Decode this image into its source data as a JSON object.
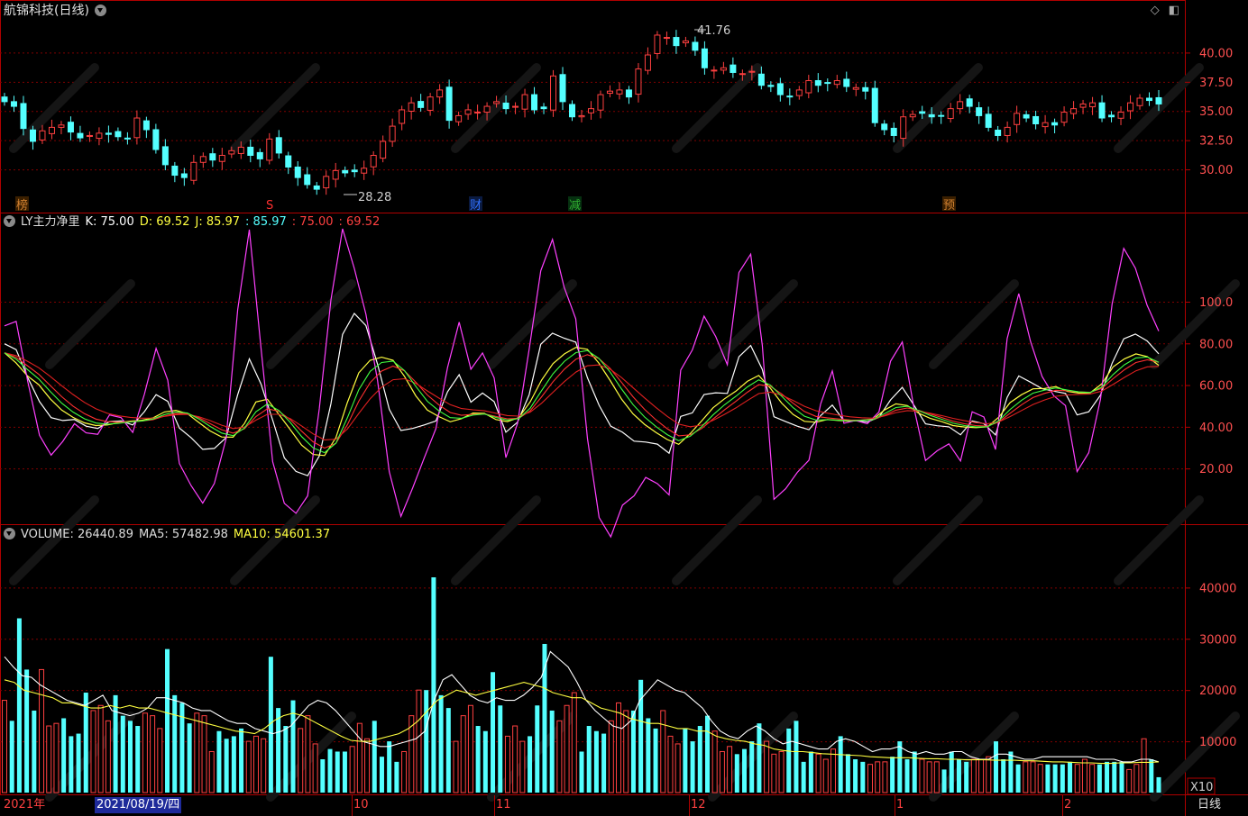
{
  "header": {
    "stock_title": "航锦科技(日线)",
    "price_high_marker": "41.76",
    "price_low_marker": "28.28"
  },
  "price_axis": [
    "40.00",
    "37.50",
    "35.00",
    "32.50",
    "30.00"
  ],
  "event_markers": [
    {
      "label": "榜",
      "color": "#d08030"
    },
    {
      "label": "S",
      "color": "#ff3030"
    },
    {
      "label": "财",
      "color": "#3070ff"
    },
    {
      "label": "减",
      "color": "#30b030"
    },
    {
      "label": "预",
      "color": "#d08030"
    }
  ],
  "kdj_panel": {
    "name": "LY主力净里",
    "k_label": "K: 75.00",
    "d_label": "D: 69.52",
    "j_label": "J: 85.97",
    "extra1": ": 85.97",
    "extra2": ": 75.00",
    "extra3": ": 69.52",
    "axis": [
      "100.0",
      "80.00",
      "60.00",
      "40.00",
      "20.00"
    ]
  },
  "volume_panel": {
    "volume_label": "VOLUME: 26440.89",
    "ma5_label": "MA5: 57482.98",
    "ma10_label": "MA10: 54601.37",
    "axis": [
      "40000",
      "30000",
      "20000",
      "10000"
    ],
    "multiplier": "X10"
  },
  "footer": {
    "year_label": "2021年",
    "selected_date": "2021/08/19/四",
    "months": [
      "10",
      "11",
      "12",
      "1",
      "2"
    ],
    "period": "日线"
  },
  "colors": {
    "up": "#ff4040",
    "down": "#54ffff",
    "k_line": "#ffffff",
    "d_line": "#ffff40",
    "j_line": "#ff40ff",
    "grid": "#800000",
    "border": "#b00000"
  },
  "chart_data": [
    {
      "type": "candlestick",
      "title": "航锦科技(日线)",
      "ylim": [
        28,
        42.5
      ],
      "ticks": [
        30,
        32.5,
        35,
        37.5,
        40
      ],
      "annotations": [
        {
          "label": "41.76",
          "value": 41.76
        },
        {
          "label": "28.28",
          "value": 28.28
        }
      ],
      "closes": [
        35.8,
        35.4,
        33.5,
        32.4,
        33.3,
        33.6,
        33.8,
        33.2,
        32.7,
        32.9,
        33.1,
        33.0,
        32.8,
        32.6,
        34.4,
        33.4,
        31.7,
        30.4,
        29.5,
        29.3,
        30.6,
        31.1,
        30.8,
        31.2,
        31.6,
        31.9,
        31.2,
        30.9,
        32.6,
        31.4,
        30.2,
        29.3,
        28.7,
        28.3,
        29.4,
        29.9,
        29.7,
        29.8,
        30.1,
        31.2,
        32.4,
        33.7,
        35.1,
        35.7,
        35.3,
        36.2,
        36.8,
        34.2,
        34.6,
        35.1,
        34.9,
        35.4,
        35.8,
        35.2,
        35.4,
        36.4,
        35.1,
        35.2,
        38.0,
        35.8,
        34.5,
        34.6,
        35.2,
        36.4,
        36.7,
        36.8,
        36.2,
        38.6,
        39.8,
        41.5,
        41.3,
        40.6,
        41.0,
        40.2,
        38.7,
        38.5,
        38.7,
        38.3,
        38.2,
        38.4,
        37.2,
        37.1,
        36.4,
        36.2,
        36.8,
        37.6,
        37.2,
        37.4,
        37.6,
        37.1,
        37.0,
        36.7,
        34.0,
        33.4,
        32.9,
        34.5,
        34.7,
        34.8,
        34.5,
        34.6,
        35.2,
        35.8,
        35.4,
        34.6,
        33.6,
        32.9,
        33.6,
        34.8,
        34.4,
        33.9,
        34.0,
        33.8,
        34.9,
        35.2,
        35.6,
        35.7,
        34.4,
        34.5,
        34.9,
        35.7,
        36.1,
        35.9,
        35.6
      ]
    },
    {
      "type": "line",
      "title": "LY主力净里",
      "ylim": [
        -5,
        135
      ],
      "ticks": [
        20,
        40,
        60,
        80,
        100
      ],
      "series": [
        {
          "name": "K",
          "values": [
            79.8,
            77.0,
            63.5,
            52.1,
            44.4,
            43.0,
            43.5,
            40.3,
            39.2,
            42.5,
            42.8,
            40.9,
            47.3,
            55.4,
            52.2,
            39.4,
            34.8,
            29.2,
            29.6,
            34.8,
            55.4,
            72.6,
            60.6,
            43.2,
            25.1,
            18.6,
            16.5,
            26.0,
            51.1,
            84.3,
            94.4,
            88.6,
            70.0,
            48.4,
            38.2,
            39.2,
            40.9,
            42.8,
            56.8,
            65.0,
            51.8,
            56.2,
            52.1,
            37.4,
            42.2,
            55.3,
            79.6,
            84.9,
            82.5,
            80.6,
            63.5,
            50.3,
            40.3,
            37.4,
            33.1,
            32.7,
            31.7,
            27.3,
            45.0,
            46.7,
            55.5,
            56.3,
            56.0,
            73.6,
            79.0,
            67.5,
            44.8,
            42.5,
            40.3,
            38.6,
            45.4,
            50.4,
            42.9,
            43.0,
            42.3,
            44.5,
            52.9,
            58.9,
            50.4,
            41.4,
            40.5,
            40.0,
            36.2,
            42.8,
            41.5,
            36.1,
            54.1,
            64.4,
            61.4,
            58.3,
            57.1,
            56.0,
            45.7,
            47.2,
            55.2,
            70.5,
            82.2,
            84.5,
            81.2,
            75.0
          ]
        },
        {
          "name": "D",
          "values": [
            75.5,
            70.7,
            64.5,
            60.2,
            53.4,
            48.0,
            44.5,
            41.9,
            40.6,
            40.9,
            42.0,
            42.7,
            43.1,
            44.3,
            47.1,
            47.9,
            46.3,
            42.1,
            38.0,
            35.1,
            35.0,
            41.6,
            51.9,
            53.2,
            46.0,
            38.7,
            31.2,
            26.7,
            26.2,
            34.8,
            51.6,
            65.9,
            71.9,
            73.4,
            71.9,
            64.2,
            54.8,
            48.0,
            44.9,
            42.4,
            43.9,
            46.6,
            46.4,
            43.5,
            42.5,
            44.4,
            52.0,
            62.4,
            70.3,
            75.0,
            78.1,
            77.2,
            70.6,
            62.2,
            53.2,
            46.2,
            41.2,
            37.3,
            33.9,
            31.6,
            36.7,
            42.8,
            49.1,
            53.4,
            57.1,
            61.8,
            64.6,
            58.6,
            51.4,
            45.9,
            42.6,
            42.2,
            43.5,
            43.0,
            42.7,
            43.2,
            43.6,
            48.0,
            51.0,
            50.2,
            46.5,
            44.1,
            42.5,
            40.6,
            39.9,
            39.6,
            40.0,
            44.6,
            51.6,
            55.4,
            58.2,
            58.4,
            59.3,
            57.0,
            56.2,
            56.3,
            60.5,
            68.7,
            72.6,
            75.0,
            73.7,
            69.5
          ]
        },
        {
          "name": "J",
          "values": [
            88.4,
            90.6,
            61.5,
            35.9,
            26.4,
            33.0,
            41.5,
            37.1,
            36.4,
            45.7,
            44.4,
            37.3,
            55.7,
            77.6,
            62.4,
            22.4,
            11.8,
            3.4,
            12.8,
            34.2,
            96.2,
            134.6,
            78.0,
            23.2,
            3.3,
            -1.5,
            6.9,
            48.7,
            100.9,
            135.0,
            116.0,
            94.0,
            62.2,
            18.4,
            -3.0,
            10.5,
            25.1,
            39.1,
            68.4,
            90.2,
            67.6,
            75.4,
            63.5,
            25.2,
            41.6,
            77.1,
            114.8,
            129.9,
            107.0,
            91.8,
            34.3,
            -3.5,
            -12.8,
            2.4,
            6.9,
            15.7,
            12.7,
            7.3,
            67.2,
            76.9,
            93.1,
            83.3,
            69.8,
            114.0,
            122.8,
            79.0,
            5.2,
            10.3,
            18.1,
            24.0,
            51.0,
            66.8,
            41.7,
            43.0,
            41.5,
            47.1,
            71.5,
            80.7,
            49.2,
            23.8,
            28.5,
            31.8,
            23.6,
            47.2,
            44.7,
            29.1,
            82.3,
            103.9,
            81.0,
            64.1,
            54.9,
            50.2,
            18.5,
            27.6,
            53.2,
            98.9,
            125.6,
            116.1,
            98.3,
            85.9
          ]
        }
      ]
    },
    {
      "type": "bar",
      "title": "VOLUME",
      "ylim": [
        0,
        48500
      ],
      "ticks": [
        10000,
        20000,
        30000,
        40000
      ],
      "values": [
        18000,
        14000,
        34000,
        24000,
        16000,
        24000,
        13000,
        13500,
        14500,
        11000,
        11500,
        19500,
        16000,
        17000,
        14000,
        19000,
        15000,
        14000,
        13000,
        15500,
        15000,
        12500,
        28000,
        19000,
        17500,
        13500,
        15500,
        15000,
        8000,
        12000,
        10500,
        11000,
        12500,
        10000,
        11000,
        10500,
        26500,
        16500,
        13000,
        18000,
        12500,
        15000,
        9500,
        6500,
        8500,
        8000,
        8000,
        9000,
        13500,
        10500,
        14000,
        7000,
        10000,
        6000,
        8000,
        15000,
        20000,
        20000,
        42000,
        19000,
        16500,
        10000,
        15000,
        17000,
        13000,
        12000,
        23500,
        17000,
        11000,
        13000,
        10000,
        11000,
        17000,
        29000,
        16000,
        14000,
        17000,
        19500,
        8000,
        13000,
        12000,
        11500,
        14000,
        17500,
        16000,
        16000,
        22000,
        14500,
        12500,
        16000,
        11000,
        9500,
        12500,
        10000,
        13000,
        15000,
        12000,
        8000,
        9000,
        7500,
        8500,
        10000,
        13500,
        10000,
        7500,
        8000,
        12500,
        14000,
        6000,
        8000,
        7500,
        6500,
        8500,
        11000,
        7500,
        6500,
        6000,
        5500,
        6000,
        6000,
        7000,
        10000,
        6500,
        8000,
        6500,
        6000,
        6000,
        4500,
        8000,
        6500,
        6000,
        6500,
        6500,
        7000,
        10000,
        6500,
        8000,
        5500,
        6000,
        6000,
        5500,
        5500,
        5500,
        5500,
        6000,
        5500,
        6500,
        5500,
        5500,
        6000,
        6000,
        6000,
        4500,
        5500,
        10500,
        6500,
        3000
      ],
      "series": [
        {
          "name": "MA5",
          "values": [
            26500,
            24500,
            22800,
            22500,
            21000,
            20000,
            19000,
            18000,
            17500,
            17000,
            18000,
            19000,
            16000,
            15500,
            15000,
            15500,
            16500,
            18500,
            18500,
            18000,
            17500,
            16500,
            16000,
            16000,
            15000,
            14000,
            13500,
            13500,
            12500,
            12000,
            11500,
            12000,
            13000,
            15000,
            17000,
            18000,
            17500,
            16000,
            14000,
            12000,
            10000,
            9500,
            9000,
            9000,
            9500,
            10000,
            10500,
            12000,
            18000,
            22000,
            23000,
            21000,
            19000,
            18000,
            17500,
            18500,
            18000,
            18000,
            19000,
            20500,
            22500,
            27500,
            26000,
            24500,
            21500,
            18000,
            16000,
            14500,
            13000,
            12500,
            14000,
            18000,
            20000,
            22000,
            21000,
            20000,
            19500,
            18000,
            16500,
            14000,
            12000,
            11000,
            10500,
            12000,
            13000,
            12000,
            10500,
            9500,
            10000,
            9500,
            9000,
            8500,
            8500,
            10000,
            10500,
            10000,
            9000,
            8000,
            8500,
            8500,
            9000,
            8000,
            7500,
            8000,
            7500,
            7500,
            8000,
            8000,
            7000,
            6500,
            6500,
            7500,
            7500,
            7000,
            6500,
            6500,
            7000,
            7000,
            7000,
            7000,
            7000,
            7000,
            6500,
            6500,
            6500,
            6000,
            6000,
            6500,
            6500,
            6000
          ]
        },
        {
          "name": "MA10",
          "values": [
            22000,
            21500,
            20000,
            19500,
            19000,
            18500,
            17500,
            17500,
            17000,
            16500,
            16500,
            17000,
            16500,
            17000,
            16500,
            16500,
            16000,
            15500,
            15000,
            14500,
            14000,
            13500,
            13000,
            12500,
            12000,
            11800,
            11500,
            12500,
            14000,
            15000,
            15500,
            15000,
            14000,
            13000,
            12000,
            11000,
            10200,
            10000,
            10000,
            10500,
            11000,
            11500,
            12500,
            14000,
            16000,
            18000,
            19000,
            20000,
            19500,
            19000,
            19500,
            20000,
            20500,
            21000,
            21500,
            21000,
            20500,
            19500,
            19000,
            18500,
            18500,
            17500,
            16500,
            16000,
            15500,
            14500,
            14000,
            13500,
            13500,
            13000,
            12500,
            12500,
            12000,
            12000,
            11000,
            10500,
            10200,
            10000,
            9500,
            9200,
            8500,
            8200,
            8000,
            8000,
            7800,
            7600,
            7500,
            7400,
            7300,
            7200,
            7000,
            6900,
            6800,
            6800,
            6800,
            6700,
            6600,
            6600,
            6500,
            6500,
            6400,
            6400,
            6400,
            6300,
            6300,
            6300,
            6200,
            6200,
            6100,
            6000,
            6000,
            5900,
            5800,
            5800,
            5700,
            5700,
            5800,
            5800,
            5900,
            5900,
            6000
          ]
        }
      ]
    }
  ]
}
